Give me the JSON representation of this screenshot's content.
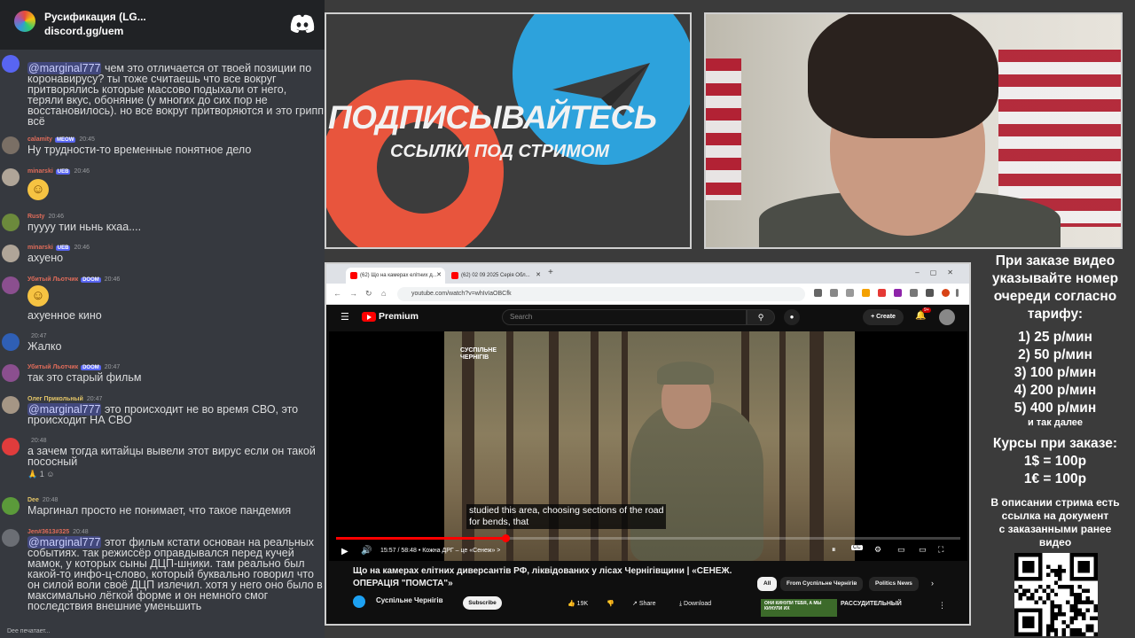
{
  "chat": {
    "server_name": "Русификация (LG...",
    "server_invite": "discord.gg/uem",
    "typing": "Dee печатает...",
    "messages": [
      {
        "user": "",
        "time": "",
        "name_color": "#b9bbbe",
        "avatar_color": "#5865f2",
        "mention": "@marginal777",
        "text": " чем это отличается от твоей позиции по коронавирусу? ты тоже считаешь что все вокруг притворялись которые массово подыхали от него, теряли вкус, обоняние (у многих до сих пор не восстановилось). но все вокруг притворяются и это грипп всё"
      },
      {
        "user": "calamity",
        "time": "20:45",
        "badge": "MEOW",
        "name_color": "#e06c5a",
        "avatar_color": "#7a6f65",
        "mention": "",
        "text": "Ну трудности-то временные понятное дело"
      },
      {
        "user": "minarski",
        "time": "20:46",
        "badge": "UEB",
        "name_color": "#e06c5a",
        "avatar_color": "#b0a598",
        "mention": "",
        "text": ""
      },
      {
        "user": "Rusty",
        "time": "20:46",
        "name_color": "#e06c5a",
        "avatar_color": "#6c8a3c",
        "mention": "",
        "text": "пуууу тии ньнь кхаа...."
      },
      {
        "user": "minarski",
        "time": "20:46",
        "badge": "UEB",
        "name_color": "#e06c5a",
        "avatar_color": "#b0a598",
        "mention": "",
        "text": "ахуено"
      },
      {
        "user": "Убитый Льотчик",
        "time": "20:46",
        "badge": "DOOM",
        "name_color": "#e06c5a",
        "avatar_color": "#8b4f8f",
        "mention": "",
        "text": "ахуенное кино"
      },
      {
        "user": "",
        "time": "20:47",
        "name_color": "#b9bbbe",
        "avatar_color": "#2f5fb5",
        "mention": "",
        "text": "Жалко"
      },
      {
        "user": "Убитый Льотчик",
        "time": "20:47",
        "badge": "DOOM",
        "name_color": "#e06c5a",
        "avatar_color": "#8b4f8f",
        "mention": "",
        "text": "так это старый фильм"
      },
      {
        "user": "Олег Прикольный",
        "time": "20:47",
        "name_color": "#e3c567",
        "avatar_color": "#a59685",
        "mention": "@marginal777",
        "text": " это происходит не во время СВО, это происходит НА СВО"
      },
      {
        "user": "",
        "time": "20:48",
        "name_color": "#b9bbbe",
        "avatar_color": "#e03c3c",
        "mention": "",
        "text": "а зачем тогда китайцы вывели этот вирус если он такой пососный",
        "reacts": "1"
      },
      {
        "user": "Dee",
        "time": "20:48",
        "name_color": "#e3c567",
        "avatar_color": "#5b9a3a",
        "mention": "",
        "text": "Маргинал просто не понимает, что такое пандемия"
      },
      {
        "user": "Jen#3613#325",
        "time": "20:48",
        "name_color": "#e06c5a",
        "avatar_color": "#6b6e74",
        "mention": "@marginal777",
        "text": " этот фильм кстати основан на реальных событиях. так режиссёр оправдывался перед кучей мамок, у которых сыны ДЦП-шники. там реально был какой-то инфо-ц-слово, который буквально говорил что он силой воли своё ДЦП излечил. хотя у него оно было в максимально лёгкой форме и он немного смог последствия внешние уменьшить"
      }
    ]
  },
  "promo": {
    "title": "ПОДПИСЫВАЙТЕСЬ",
    "subtitle": "ССЫЛКИ ПОД СТРИМОМ"
  },
  "pricing": {
    "intro": [
      "При заказе видео",
      "указывайте номер",
      "очереди согласно",
      "тарифу:"
    ],
    "tiers": [
      "1) 25 р/мин",
      "2) 50 р/мин",
      "3) 100 р/мин",
      "4) 200 р/мин",
      "5) 400 р/мин"
    ],
    "etc": "и так далее",
    "rates_title": "Курсы при заказе:",
    "rates": [
      "1$ = 100р",
      "1€ = 100р"
    ],
    "desc": [
      "В описании стрима есть",
      "ссылка на документ",
      "с заказанными ранее",
      "видео"
    ]
  },
  "browser": {
    "tabs": [
      "(62) Що на камерах елітних д...",
      "(62) 02 09 2025 Серія Обл..."
    ],
    "url": "youtube.com/watch?v=whIvIaOBCfk"
  },
  "youtube": {
    "brand": "Premium",
    "search_placeholder": "Search",
    "create_label": "Create",
    "notif_count": "9+",
    "watermark": "СУСПІЛЬНЕ\nЧЕРНІГІВ",
    "caption": "studied this area, choosing sections of the road\nfor bends, that",
    "time": "15:57 / 58:48",
    "chapter": "• Кожна ДРГ – це «Сенеж» >",
    "progress": 0.272,
    "title": "Що на камерах елітних диверсантів РФ, ліквідованих у лісах Чернігівщини | «СЕНЕЖ. ОПЕРАЦІЯ \"ПОМСТА\"»",
    "channel": "Суспільне Чернігів",
    "subscribe": "Subscribe",
    "likes": "19K",
    "share": "Share",
    "download": "Download",
    "chips": [
      "All",
      "From Суспільне Чернігів",
      "Politics News"
    ],
    "ad_thumb_text": "ОНИ КИНУЛИ ТЕБЯ, А МЫ КИНУЛИ ИХ",
    "ad_title": "РАССУДИТЕЛЬНЫЙ"
  }
}
